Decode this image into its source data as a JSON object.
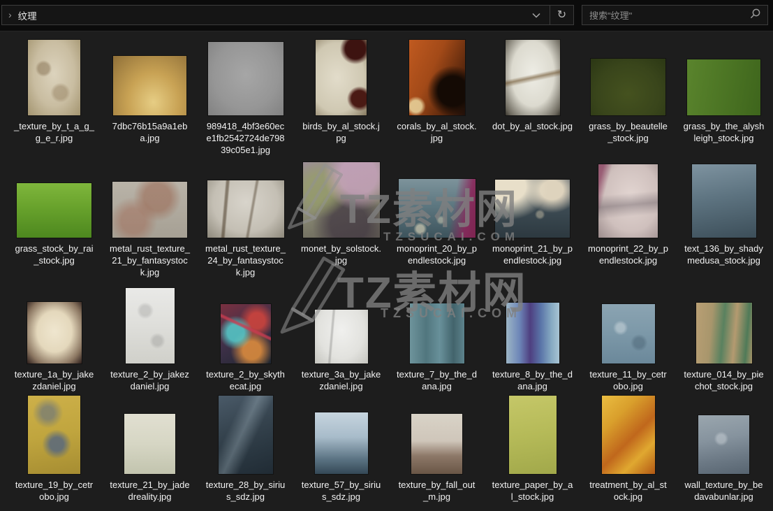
{
  "topbar": {
    "breadcrumb_chevron": "›",
    "location": "纹理",
    "refresh_glyph": "↻",
    "search_placeholder": "搜索\"纹理\""
  },
  "watermark": {
    "brand": "TZ素材网",
    "domain": "TZSUCAI.COM",
    "color": "#808080"
  },
  "colors": {
    "topbar_bg": "#0b0b0b",
    "content_bg": "#1d1d1d",
    "field_border": "#3c3c3c",
    "caption_text": "#f2f2f2"
  },
  "grid": {
    "rows": [
      {
        "items": [
          {
            "label": "_texture_by_t_a_g_g_e_r.jpg",
            "w": 75,
            "h": 108,
            "bg": "radial-gradient(circle at 30% 38%, rgba(138,118,88,0.55) 0 9%, transparent 14%), radial-gradient(circle at 62% 70%, rgba(150,130,98,0.5) 0 10%, transparent 16%), radial-gradient(ellipse at 50% 45%, #dcd3bd 0%, #c9bda1 55%, #a3946f 100%)"
          },
          {
            "label": "7dbc76b15a9a1eba.jpg",
            "w": 105,
            "h": 85,
            "bg": "radial-gradient(ellipse at 55% 78%, #e6cd84 0%, #c8a254 45%, #8f6f38 100%)"
          },
          {
            "label": "989418_4bf3e60ece1fb2542724de79839c05e1.jpg",
            "w": 108,
            "h": 105,
            "bg": "radial-gradient(ellipse at 50% 45%, #a6a6a6 0%, #969696 60%, #818181 100%)"
          },
          {
            "label": "birds_by_al_stock.jpg",
            "w": 73,
            "h": 108,
            "bg": "radial-gradient(circle at 78% 12%, #3d1310 0 13%, transparent 20%), radial-gradient(circle at 86% 78%, #4a1a14 0 11%, transparent 17%), radial-gradient(ellipse at 42% 50%, #e2dcca 0%, #cfc8b2 65%, #86795f 100%)"
          },
          {
            "label": "corals_by_al_stock.jpg",
            "w": 80,
            "h": 108,
            "bg": "radial-gradient(circle at 12% 88%, rgba(235,216,160,0.85) 0 7%, transparent 12%), radial-gradient(circle at 78% 68%, #140a04 0 22%, transparent 38%), linear-gradient(115deg, #c05a20 0%, #a34a18 40%, #55250c 78%, #20100a 100%)"
          },
          {
            "label": "dot_by_al_stock.jpg",
            "w": 78,
            "h": 108,
            "bg": "linear-gradient(168deg, transparent 46%, rgba(95,65,25,0.55) 50%, transparent 55%), radial-gradient(ellipse at 50% 45%, #eeede5 0%, #dcdacf 55%, #6b675c 90%, #38352d 100%)"
          },
          {
            "label": "grass_by_beautelle_stock.jpg",
            "w": 107,
            "h": 81,
            "bg": "radial-gradient(ellipse at 50% 62%, #45521f 0%, #39451b 60%, #2b3714 100%)"
          },
          {
            "label": "grass_by_the_alyshleigh_stock.jpg",
            "w": 105,
            "h": 80,
            "bg": "linear-gradient(100deg, #5a842d 0%, #4c7524 50%, #3e651c 100%)"
          }
        ]
      },
      {
        "items": [
          {
            "label": "grass_stock_by_rai_stock.jpg",
            "w": 107,
            "h": 78,
            "bg": "linear-gradient(180deg, #7fb63c 0%, #68a22c 45%, #4d881f 100%)"
          },
          {
            "label": "metal_rust_texture_21_by_fantasystock.jpg",
            "w": 107,
            "h": 80,
            "bg": "radial-gradient(circle at 60% 28%, rgba(152,100,78,0.55) 0 22%, transparent 40%), radial-gradient(circle at 28% 70%, rgba(160,105,85,0.5) 0 18%, transparent 36%), linear-gradient(180deg, #b9b3a8 0%, #a6a094 100%)"
          },
          {
            "label": "metal_rust_texture_24_by_fantasystock.jpg",
            "w": 110,
            "h": 82,
            "bg": "linear-gradient(95deg, transparent 22%, rgba(62,46,26,0.5) 24% 26%, transparent 28%), linear-gradient(100deg, transparent 55%, rgba(62,46,26,0.4) 57% 58%, transparent 60%), radial-gradient(ellipse at 50% 38%, #d8d4cb 0%, #c4bfb4 60%, #8d887b 100%)"
          },
          {
            "label": "monet_by_solstock.jpg",
            "w": 110,
            "h": 108,
            "bg": "radial-gradient(circle at 72% 18%, rgba(205,165,195,0.75) 0 22%, transparent 42%), radial-gradient(circle at 22% 35%, rgba(152,162,100,0.6) 0 18%, transparent 38%), radial-gradient(circle at 60% 82%, rgba(66,56,66,0.75) 0 24%, transparent 48%), linear-gradient(160deg, #9c8f96 0%, #8a8a74 50%, #5f5a52 100%)"
          },
          {
            "label": "monoprint_20_by_pendlestock.jpg",
            "w": 110,
            "h": 84,
            "bg": "linear-gradient(100deg, transparent 68%, rgba(138,38,90,0.9) 86%, #7e2450 100%), radial-gradient(circle at 28% 85%, rgba(232,222,192,0.6) 0 5%, transparent 9%), radial-gradient(circle at 55% 70%, rgba(232,222,192,0.45) 0 4%, transparent 8%), linear-gradient(180deg, #7d939b 0%, #5d7780 45%, #3d535c 100%)"
          },
          {
            "label": "monoprint_21_by_pendlestock.jpg",
            "w": 107,
            "h": 83,
            "bg": "radial-gradient(ellipse at 18% 12%, #e8dfc9 0 20%, transparent 46%), radial-gradient(ellipse at 76% 18%, #ded3bd 0 14%, transparent 34%), radial-gradient(circle at 60% 60%, rgba(226,214,184,0.4) 0 5%, transparent 9%), linear-gradient(180deg, #4e5a64 0%, #39474f 60%, #2d3940 100%)"
          },
          {
            "label": "monoprint_22_by_pendlestock.jpg",
            "w": 85,
            "h": 105,
            "bg": "linear-gradient(105deg, rgba(128,32,76,0.55) 0 7%, transparent 18%), linear-gradient(175deg, transparent 40%, rgba(70,60,70,0.35) 55%, transparent 70%), radial-gradient(ellipse at 55% 45%, #e3d6d2 0%, #cfc0bd 60%, #9c8c8c 100%)"
          },
          {
            "label": "text_136_by_shadymedusa_stock.jpg",
            "w": 92,
            "h": 105,
            "bg": "linear-gradient(170deg, #7e93a0 0%, #5d7380 45%, #3c4e59 100%)"
          }
        ]
      },
      {
        "items": [
          {
            "label": "texture_1a_by_jakezdaniel.jpg",
            "w": 78,
            "h": 88,
            "bg": "radial-gradient(ellipse at 50% 48%, #efe6cf 0%, #e4d8bc 45%, #8a7560 78%, #2c1e1b 100%)"
          },
          {
            "label": "texture_2_by_jakezdaniel.jpg",
            "w": 70,
            "h": 108,
            "bg": "radial-gradient(circle at 40% 30%, rgba(160,160,158,0.4) 0 8%, transparent 14%), radial-gradient(circle at 65% 70%, rgba(150,150,148,0.4) 0 7%, transparent 13%), linear-gradient(180deg, #e9e9e7 0%, #dededa 50%, #d0d0ca 100%)"
          },
          {
            "label": "texture_2_by_skythecat.jpg",
            "w": 72,
            "h": 85,
            "bg": "linear-gradient(25deg, transparent 55%, rgba(200,60,80,0.8) 57% 59%, transparent 61%), radial-gradient(circle at 30% 48%, rgba(85,205,205,0.85) 0 18%, transparent 36%), radial-gradient(circle at 72% 28%, rgba(222,70,60,0.8) 0 14%, transparent 32%), radial-gradient(circle at 62% 78%, rgba(242,152,62,0.8) 0 16%, transparent 38%), linear-gradient(150deg, #7a3040 0%, #3e3048 50%, #1e2630 100%)"
          },
          {
            "label": "texture_3a_by_jakezdaniel.jpg",
            "w": 76,
            "h": 77,
            "bg": "linear-gradient(95deg, transparent 30%, rgba(120,120,118,0.35) 32% 34%, transparent 36%), radial-gradient(ellipse at 50% 38%, #f0f0ee 0%, #e2e2de 60%, #c4c4be 100%)"
          },
          {
            "label": "texture_7_by_the_dana.jpg",
            "w": 78,
            "h": 86,
            "bg": "linear-gradient(90deg, #6e949c 0%, #51767e 30%, #68909a 55%, #43646c 80%, #5d838c 100%)"
          },
          {
            "label": "texture_8_by_the_dana.jpg",
            "w": 76,
            "h": 87,
            "bg": "linear-gradient(90deg, #9db6c6 0%, #6d86b8 25%, #4e3f80 45%, #5a74a8 65%, #86aac2 85%, #a8c4d4 100%)"
          },
          {
            "label": "texture_11_by_cetrobo.jpg",
            "w": 76,
            "h": 85,
            "bg": "radial-gradient(circle at 35% 40%, rgba(220,228,232,0.45) 0 8%, transparent 15%), radial-gradient(circle at 70% 65%, rgba(70,95,112,0.45) 0 9%, transparent 16%), linear-gradient(180deg, #8ba4b2 0%, #7c98a8 50%, #6b889a 100%)"
          },
          {
            "label": "texture_014_by_piechot_stock.jpg",
            "w": 80,
            "h": 87,
            "bg": "linear-gradient(95deg, #b99f74 0%, #a8966c 28%, #59815f 48%, #b49a70 68%, #4f7a58 88%, #a89468 100%)"
          }
        ]
      },
      {
        "items": [
          {
            "label": "texture_19_by_cetrobo.jpg",
            "w": 75,
            "h": 112,
            "bg": "radial-gradient(circle at 55% 62%, rgba(88,104,126,0.85) 0 12%, transparent 26%), radial-gradient(circle at 38% 22%, rgba(95,110,132,0.6) 0 9%, transparent 22%), linear-gradient(170deg, #cdb049 0%, #c0a53e 50%, #a68d32 100%)"
          },
          {
            "label": "texture_21_by_jadedreality.jpg",
            "w": 73,
            "h": 86,
            "bg": "linear-gradient(180deg, #e1dfd1 0%, #d6d6c4 50%, #c2c4ae 100%)"
          },
          {
            "label": "texture_28_by_sirius_sdz.jpg",
            "w": 78,
            "h": 112,
            "bg": "linear-gradient(115deg, transparent 28%, rgba(202,222,232,0.28) 45%, transparent 62%), linear-gradient(160deg, #4a5a68 0%, #36444f 40%, #2a3741 70%, #202b34 100%)"
          },
          {
            "label": "texture_57_by_sirius_sdz.jpg",
            "w": 76,
            "h": 88,
            "bg": "linear-gradient(180deg, #c6d4de 0%, #a8bcca 40%, #5d7585 75%, #344856 100%)"
          },
          {
            "label": "texture_by_fall_out_m.jpg",
            "w": 73,
            "h": 86,
            "bg": "linear-gradient(180deg, #d9d3c7 0%, #cfc6ba 45%, #8d7868 70%, #695646 100%)"
          },
          {
            "label": "texture_paper_by_al_stock.jpg",
            "w": 68,
            "h": 112,
            "bg": "linear-gradient(170deg, #c5c768 0%, #b5ba58 50%, #a1a84a 100%)"
          },
          {
            "label": "treatment_by_al_stock.jpg",
            "w": 76,
            "h": 112,
            "bg": "linear-gradient(135deg, #eabd41 0%, #d99f2c 28%, #c0671c 55%, #e0a830 75%, #b25814 100%)"
          },
          {
            "label": "wall_texture_by_bedavabunlar.jpg",
            "w": 73,
            "h": 84,
            "bg": "radial-gradient(circle at 45% 40%, rgba(220,226,230,0.4) 0 9%, transparent 16%), linear-gradient(170deg, #9aa6ae 0%, #86939e 40%, #6d7a86 70%, #576470 100%)"
          }
        ]
      }
    ]
  }
}
